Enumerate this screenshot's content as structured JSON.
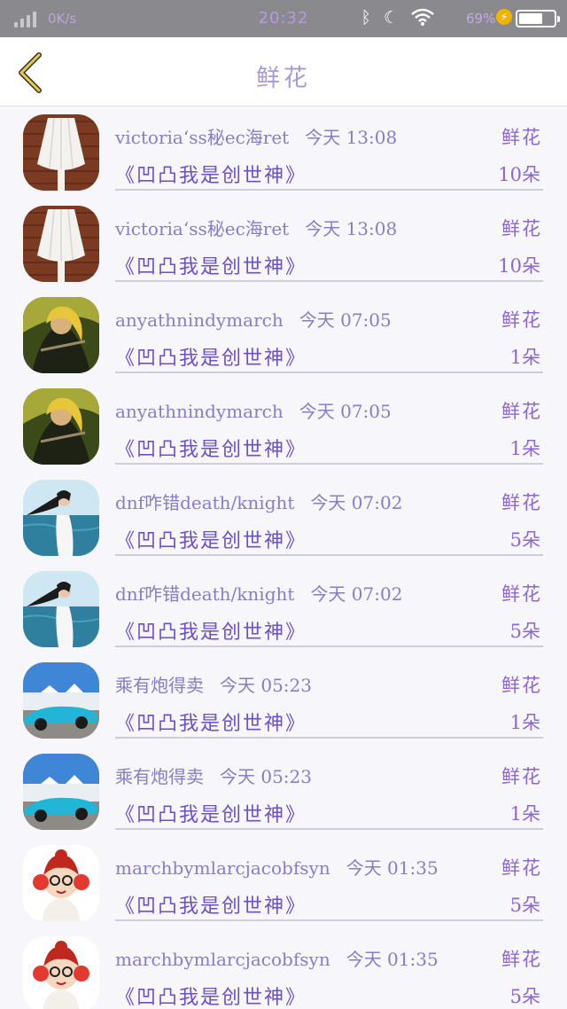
{
  "status_bar": {
    "net_speed": "0K/s",
    "time": "20:32",
    "battery_percent": "69%",
    "battery_level": 0.69
  },
  "nav": {
    "title": "鲜花"
  },
  "records": [
    {
      "username": "victoria‘ss秘ec海ret",
      "date": "今天 13:08",
      "book": "《凹凸我是创世神》",
      "gift": "鲜花",
      "count": "10朵",
      "avatar": "lamp"
    },
    {
      "username": "victoria‘ss秘ec海ret",
      "date": "今天 13:08",
      "book": "《凹凸我是创世神》",
      "gift": "鲜花",
      "count": "10朵",
      "avatar": "lamp"
    },
    {
      "username": "anyathnindymarch",
      "date": "今天 07:05",
      "book": "《凹凸我是创世神》",
      "gift": "鲜花",
      "count": "1朵",
      "avatar": "warrior"
    },
    {
      "username": "anyathnindymarch",
      "date": "今天 07:05",
      "book": "《凹凸我是创世神》",
      "gift": "鲜花",
      "count": "1朵",
      "avatar": "warrior"
    },
    {
      "username": "dnf咋错death/knight",
      "date": "今天 07:02",
      "book": "《凹凸我是创世神》",
      "gift": "鲜花",
      "count": "5朵",
      "avatar": "sea-girl"
    },
    {
      "username": "dnf咋错death/knight",
      "date": "今天 07:02",
      "book": "《凹凸我是创世神》",
      "gift": "鲜花",
      "count": "5朵",
      "avatar": "sea-girl"
    },
    {
      "username": "乘有炮得卖",
      "date": "今天 05:23",
      "book": "《凹凸我是创世神》",
      "gift": "鲜花",
      "count": "1朵",
      "avatar": "car"
    },
    {
      "username": "乘有炮得卖",
      "date": "今天 05:23",
      "book": "《凹凸我是创世神》",
      "gift": "鲜花",
      "count": "1朵",
      "avatar": "car"
    },
    {
      "username": "marchbymlarcjacobfsyn",
      "date": "今天 01:35",
      "book": "《凹凸我是创世神》",
      "gift": "鲜花",
      "count": "5朵",
      "avatar": "cartoon"
    },
    {
      "username": "marchbymlarcjacobfsyn",
      "date": "今天 01:35",
      "book": "《凹凸我是创世神》",
      "gift": "鲜花",
      "count": "5朵",
      "avatar": "cartoon"
    }
  ]
}
